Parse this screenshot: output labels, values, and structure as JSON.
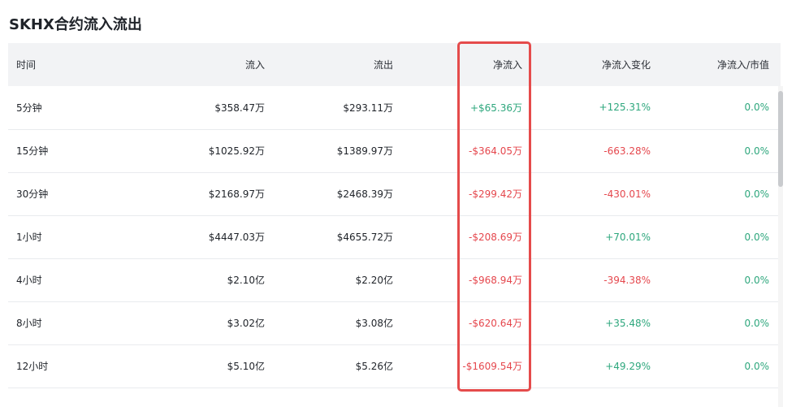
{
  "title": "SKHX合约流入流出",
  "columns": [
    "时间",
    "流入",
    "流出",
    "净流入",
    "净流入变化",
    "净流入/市值"
  ],
  "rows": [
    {
      "time": "5分钟",
      "inflow": "$358.47万",
      "outflow": "$293.11万",
      "net": "+$65.36万",
      "net_status": "pos",
      "change": "+125.31%",
      "change_status": "pos",
      "ratio": "0.0%"
    },
    {
      "time": "15分钟",
      "inflow": "$1025.92万",
      "outflow": "$1389.97万",
      "net": "-$364.05万",
      "net_status": "neg",
      "change": "-663.28%",
      "change_status": "neg",
      "ratio": "0.0%"
    },
    {
      "time": "30分钟",
      "inflow": "$2168.97万",
      "outflow": "$2468.39万",
      "net": "-$299.42万",
      "net_status": "neg",
      "change": "-430.01%",
      "change_status": "neg",
      "ratio": "0.0%"
    },
    {
      "time": "1小时",
      "inflow": "$4447.03万",
      "outflow": "$4655.72万",
      "net": "-$208.69万",
      "net_status": "neg",
      "change": "+70.01%",
      "change_status": "pos",
      "ratio": "0.0%"
    },
    {
      "time": "4小时",
      "inflow": "$2.10亿",
      "outflow": "$2.20亿",
      "net": "-$968.94万",
      "net_status": "neg",
      "change": "-394.38%",
      "change_status": "neg",
      "ratio": "0.0%"
    },
    {
      "time": "8小时",
      "inflow": "$3.02亿",
      "outflow": "$3.08亿",
      "net": "-$620.64万",
      "net_status": "neg",
      "change": "+35.48%",
      "change_status": "pos",
      "ratio": "0.0%"
    },
    {
      "time": "12小时",
      "inflow": "$5.10亿",
      "outflow": "$5.26亿",
      "net": "-$1609.54万",
      "net_status": "neg",
      "change": "+49.29%",
      "change_status": "pos",
      "ratio": "0.0%"
    }
  ],
  "colors": {
    "positive": "#2ea77d",
    "negative": "#e5474d",
    "highlight": "#e54b4b",
    "header_bg": "#f2f3f5"
  }
}
